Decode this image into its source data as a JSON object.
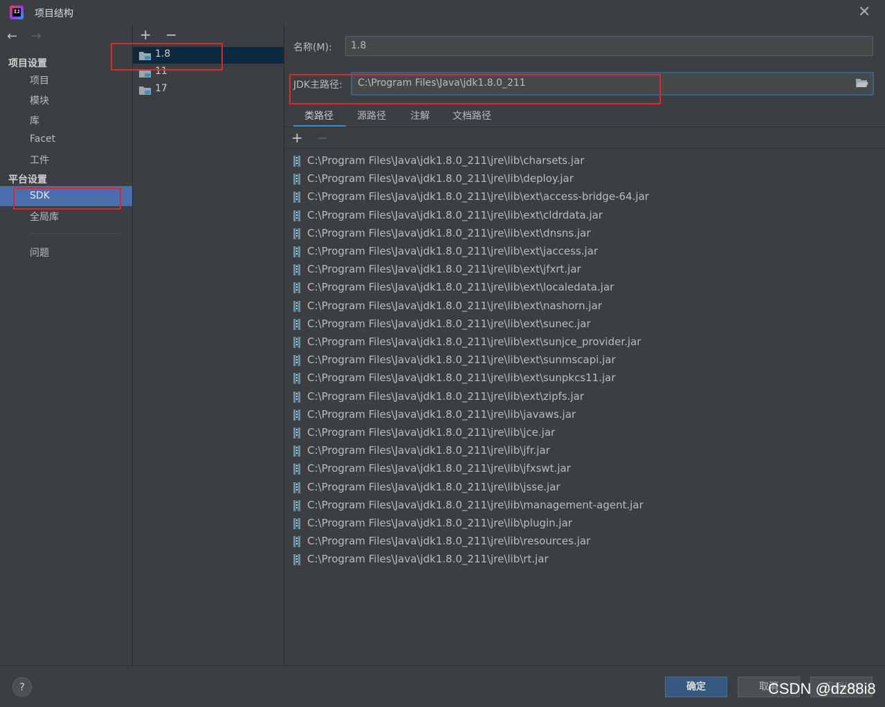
{
  "window": {
    "title": "项目结构",
    "close": "✕"
  },
  "nav": {
    "back": "←",
    "forward": "→",
    "section_project": "项目设置",
    "project_items": [
      "项目",
      "模块",
      "库",
      "Facet",
      "工件"
    ],
    "section_platform": "平台设置",
    "platform_items": [
      "SDK",
      "全局库"
    ],
    "problems": "问题",
    "selected": "SDK"
  },
  "sdk_list": {
    "add": "+",
    "remove": "−",
    "items": [
      "1.8",
      "11",
      "17"
    ],
    "selected": "1.8"
  },
  "detail": {
    "name_label": "名称(M):",
    "name_value": "1.8",
    "jdk_label": "JDK主路径:",
    "jdk_value": "C:\\Program Files\\Java\\jdk1.8.0_211",
    "tabs": [
      "类路径",
      "源路径",
      "注解",
      "文档路径"
    ],
    "active_tab": "类路径",
    "add": "+",
    "remove": "−",
    "classpath": [
      "C:\\Program Files\\Java\\jdk1.8.0_211\\jre\\lib\\charsets.jar",
      "C:\\Program Files\\Java\\jdk1.8.0_211\\jre\\lib\\deploy.jar",
      "C:\\Program Files\\Java\\jdk1.8.0_211\\jre\\lib\\ext\\access-bridge-64.jar",
      "C:\\Program Files\\Java\\jdk1.8.0_211\\jre\\lib\\ext\\cldrdata.jar",
      "C:\\Program Files\\Java\\jdk1.8.0_211\\jre\\lib\\ext\\dnsns.jar",
      "C:\\Program Files\\Java\\jdk1.8.0_211\\jre\\lib\\ext\\jaccess.jar",
      "C:\\Program Files\\Java\\jdk1.8.0_211\\jre\\lib\\ext\\jfxrt.jar",
      "C:\\Program Files\\Java\\jdk1.8.0_211\\jre\\lib\\ext\\localedata.jar",
      "C:\\Program Files\\Java\\jdk1.8.0_211\\jre\\lib\\ext\\nashorn.jar",
      "C:\\Program Files\\Java\\jdk1.8.0_211\\jre\\lib\\ext\\sunec.jar",
      "C:\\Program Files\\Java\\jdk1.8.0_211\\jre\\lib\\ext\\sunjce_provider.jar",
      "C:\\Program Files\\Java\\jdk1.8.0_211\\jre\\lib\\ext\\sunmscapi.jar",
      "C:\\Program Files\\Java\\jdk1.8.0_211\\jre\\lib\\ext\\sunpkcs11.jar",
      "C:\\Program Files\\Java\\jdk1.8.0_211\\jre\\lib\\ext\\zipfs.jar",
      "C:\\Program Files\\Java\\jdk1.8.0_211\\jre\\lib\\javaws.jar",
      "C:\\Program Files\\Java\\jdk1.8.0_211\\jre\\lib\\jce.jar",
      "C:\\Program Files\\Java\\jdk1.8.0_211\\jre\\lib\\jfr.jar",
      "C:\\Program Files\\Java\\jdk1.8.0_211\\jre\\lib\\jfxswt.jar",
      "C:\\Program Files\\Java\\jdk1.8.0_211\\jre\\lib\\jsse.jar",
      "C:\\Program Files\\Java\\jdk1.8.0_211\\jre\\lib\\management-agent.jar",
      "C:\\Program Files\\Java\\jdk1.8.0_211\\jre\\lib\\plugin.jar",
      "C:\\Program Files\\Java\\jdk1.8.0_211\\jre\\lib\\resources.jar",
      "C:\\Program Files\\Java\\jdk1.8.0_211\\jre\\lib\\rt.jar"
    ]
  },
  "footer": {
    "help": "?",
    "ok": "确定",
    "cancel": "取消",
    "apply": "应用(A)",
    "watermark": "CSDN @dz88i8"
  },
  "colors": {
    "background": "#3c3f41",
    "selection": "#4b6eaf",
    "list_selection": "#0d293e",
    "annotation_red": "#e0282a",
    "primary_button": "#365880"
  },
  "icons": {
    "app": "intellij-idea-icon",
    "sdk": "sdk-folder-icon",
    "jar": "jar-archive-icon",
    "folder": "open-folder-icon"
  }
}
